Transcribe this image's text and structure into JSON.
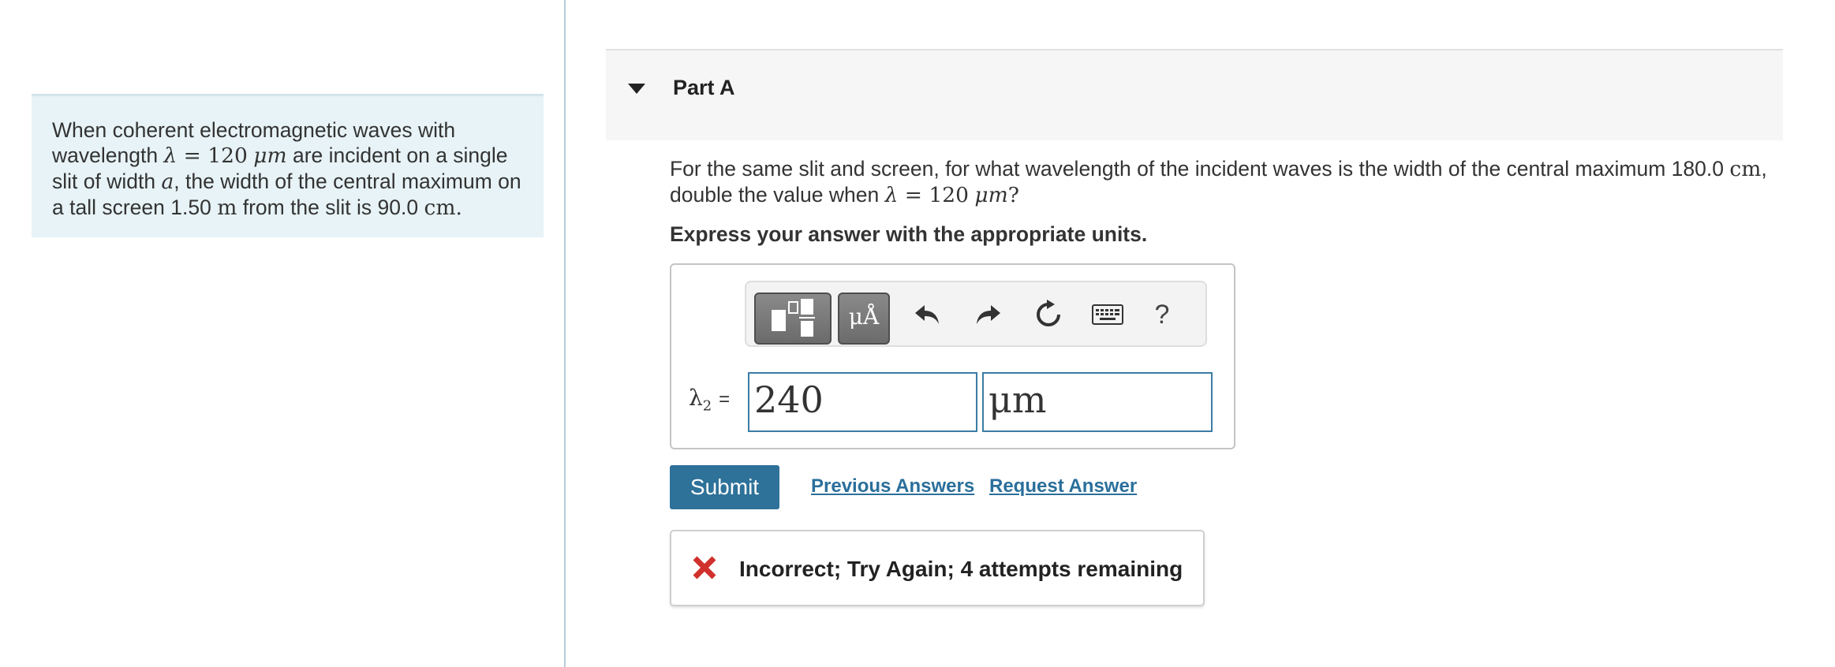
{
  "problem": {
    "text_1": "When coherent electromagnetic waves with wavelength ",
    "lambda_symbol": "λ",
    "equals": " = ",
    "wavelength_value": "120",
    "wavelength_unit": "μm",
    "text_2": " are incident on a single slit of width ",
    "width_symbol": "a",
    "text_3": ", the width of the central maximum on a tall screen ",
    "distance_value": "1.50",
    "distance_unit": "m",
    "text_4": " from the slit is ",
    "max_width_value": "90.0",
    "max_width_unit": "cm",
    "period": "."
  },
  "part": {
    "title": "Part A"
  },
  "question": {
    "text_1": "For the same slit and screen, for what wavelength of the incident waves is the width of the central maximum ",
    "new_width_value": "180.0",
    "new_width_unit": "cm",
    "text_2": ", double the value when ",
    "lambda_symbol": "λ",
    "equals": " = ",
    "wavelength_value": "120",
    "wavelength_unit": "μm",
    "question_mark": "?"
  },
  "instruction": "Express your answer with the appropriate units.",
  "answer": {
    "variable_symbol": "λ",
    "variable_subscript": "2",
    "equals": "=",
    "value": "240",
    "unit": "μm"
  },
  "toolbar": {
    "units_label": "μÅ",
    "help_label": "?",
    "icons": [
      "templates-icon",
      "units-icon",
      "undo-icon",
      "redo-icon",
      "reset-icon",
      "keyboard-icon",
      "help-icon"
    ]
  },
  "actions": {
    "submit_label": "Submit",
    "previous_answers_label": "Previous Answers",
    "request_answer_label": "Request Answer"
  },
  "feedback": {
    "message": "Incorrect; Try Again; 4 attempts remaining",
    "icon": "x-icon"
  },
  "colors": {
    "accent": "#2e7199",
    "link": "#2a6f9b",
    "error": "#d0312d",
    "problem_bg": "#e7f3f6",
    "part_header_bg": "#f6f6f6"
  }
}
